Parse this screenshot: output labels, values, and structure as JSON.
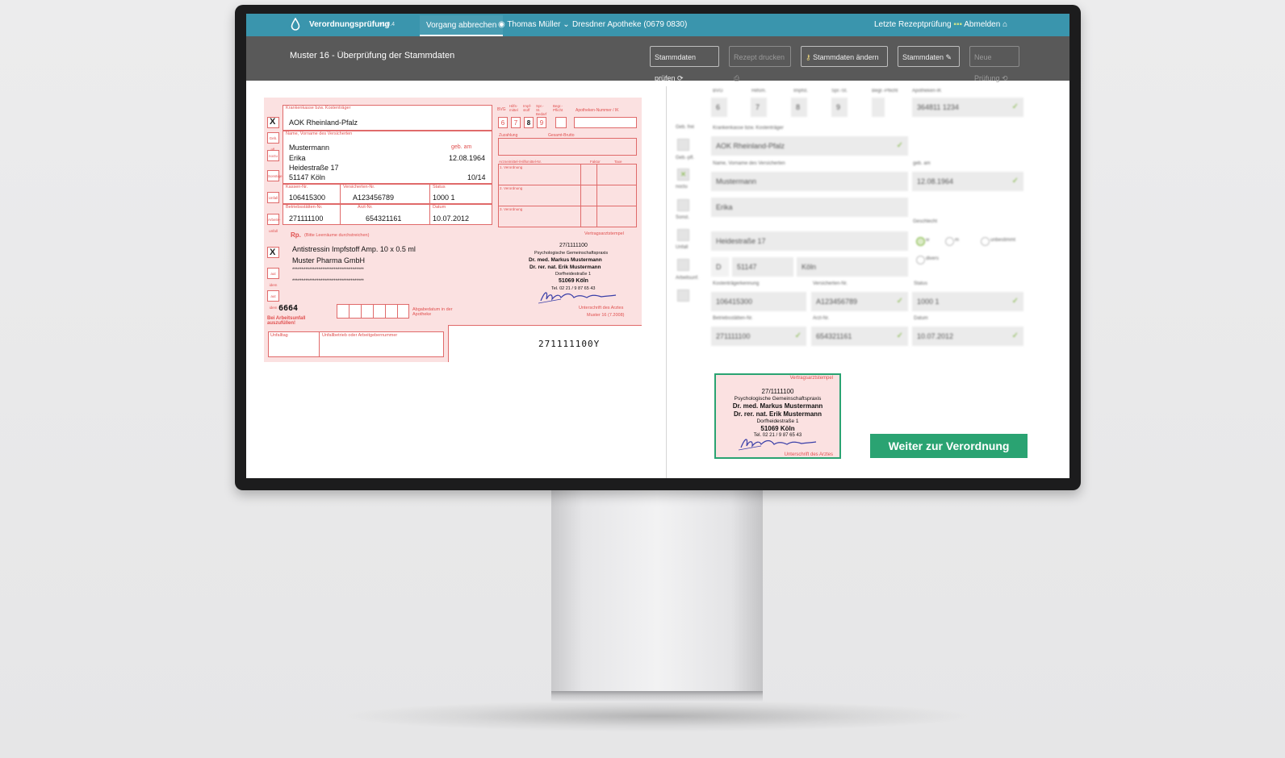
{
  "app": {
    "name": "Verordnungsprüfung",
    "version": "v1.0.4",
    "nav_tab": "Vorgang abbrechen",
    "user": "Thomas Müller",
    "pharmacy": "Dresdner Apotheke (0679 0830)",
    "right_info": "Letzte Rezeptprüfung",
    "logout": "Abmelden"
  },
  "header": {
    "title": "Muster 16 - Überprüfung der Stammdaten",
    "buttons": [
      {
        "label": "Stammdaten prüfen",
        "disabled": false
      },
      {
        "label": "Rezept drucken",
        "disabled": true
      },
      {
        "label": "Stammdaten ändern",
        "disabled": false
      },
      {
        "label": "Stammdaten",
        "disabled": false
      },
      {
        "label": "Neue Prüfung",
        "disabled": true
      }
    ]
  },
  "form": {
    "labels": {
      "krankenkasse": "Krankenkasse bzw. Kostenträger",
      "name": "Name, Vorname des Versicherten",
      "geb": "geb. am",
      "kassen_nr": "Kassen-Nr.",
      "versicherten_nr": "Versicherten-Nr.",
      "status": "Status",
      "betriebsstaetten_nr": "Betriebsstätten-Nr.",
      "arzt_nr": "Arzt-Nr.",
      "datum": "Datum",
      "rp": "Rp.",
      "rp_hint": "(Bitte Leerräume durchstreichen)",
      "vertragsarztstempel": "Vertragsarztstempel",
      "unterschrift": "Unterschrift des Arztes",
      "muster": "Muster 16 (7.2008)",
      "abgabedatum": "Abgabedatum in der Apotheke",
      "arbeitsunfall": "Bei Arbeitsunfall auszufüllen!",
      "unfalltag": "Unfalltag",
      "unfallbetrieb": "Unfallbetrieb oder Arbeitgebernummer",
      "apotheken_nr": "Apotheken-Nummer / IK",
      "zuzahlung": "Zuzahlung",
      "gesamt_brutto": "Gesamt-Brutto",
      "arzneimittel": "Arzneimittel-/Hilfsmittel-Nr.",
      "faktor": "Faktor",
      "taxe": "Taxe",
      "verordnung1": "1. Verordnung",
      "verordnung2": "2. Verordnung",
      "verordnung3": "3. Verordnung",
      "bvg": "BVG",
      "hilfsmittel": "Hilfs-mittel",
      "impfstoff": "Impf-stoff",
      "spr": "Spr.-St. Bedarf",
      "begr": "Begr.-Pflicht"
    },
    "side_boxes": [
      "Geb. pfl.",
      "noctu",
      "Sonstige",
      "Unfall",
      "Arbeits-unfall"
    ],
    "rp_side_boxes": [
      "aut idem",
      "aut idem",
      "aut idem"
    ],
    "kasse": "AOK Rheinland-Pfalz",
    "nachname": "Mustermann",
    "vorname": "Erika",
    "strasse": "Heidestraße 17",
    "ort": "51147 Köln",
    "geburtsdatum": "12.08.1964",
    "gueltig": "10/14",
    "kassen_nr": "106415300",
    "versicherten_nr": "A123456789",
    "status": "1000 1",
    "betriebsstaetten_nr": "271111100",
    "arzt_nr": "654321161",
    "datum": "10.07.2012",
    "digits": [
      "6",
      "7",
      "8",
      "9"
    ],
    "medikament": "Antistressin Impfstoff Amp. 10 x 0.5 ml",
    "hersteller": "Muster Pharma GmbH",
    "stars1": "**************************************",
    "stars2": "**************************************",
    "handnum": "6664",
    "barcode_text": "271111100Y",
    "stempel": {
      "nr": "27/1111100",
      "praxis": "Psychologische Gemeinschaftspraxis",
      "arzt1": "Dr. med. Markus Mustermann",
      "arzt2": "Dr. rer. nat. Erik Mustermann",
      "strasse": "Dorfheidestraße 1",
      "ort": "51069 Köln",
      "tel": "Tel. 02 21 / 9 87 65 43"
    }
  },
  "right_panel": {
    "top_labels": [
      "BVG",
      "Hilfsm.",
      "Impfst.",
      "Spr.-St.",
      "Begr.-Pflicht",
      "Apotheken-IK"
    ],
    "top_values": [
      "6",
      "7",
      "8",
      "9",
      "",
      "364811 1234"
    ],
    "side_labels": [
      "Geb. frei",
      "Geb.-pfl.",
      "noctu",
      "Sonst.",
      "Unfall",
      "Arbeitsunf."
    ],
    "kasse_label": "Krankenkasse bzw. Kostenträger",
    "kasse_value": "AOK Rheinland-Pfalz",
    "name_label": "Name, Vorname des Versicherten",
    "name_value": "Mustermann",
    "geb_label": "geb. am",
    "geb_value": "12.08.1964",
    "vorname_value": "Erika",
    "strasse_value": "Heidestraße 17",
    "geschlecht_label": "Geschlecht",
    "radio1": "w",
    "radio2": "m",
    "radio3": "unbestimmt",
    "radio4": "divers",
    "land_value": "D",
    "plz_value": "51147",
    "ort_value": "Köln",
    "kassen_label": "Kostenträgerkennung",
    "kassen_value": "106415300",
    "vers_label": "Versicherten-Nr.",
    "vers_value": "A123456789",
    "status_label": "Status",
    "status_value": "1000 1",
    "bsnr_label": "Betriebsstätten-Nr.",
    "bsnr_value": "271111100",
    "lanr_label": "Arzt-Nr.",
    "lanr_value": "654321161",
    "datum_label": "Datum",
    "datum_value": "10.07.2012"
  },
  "stamp": {
    "header": "Vertragsarztstempel",
    "footer": "Unterschrift des Arztes",
    "nr": "27/1111100",
    "praxis": "Psychologische Gemeinschaftspraxis",
    "arzt1": "Dr. med. Markus Mustermann",
    "arzt2": "Dr. rer. nat. Erik Mustermann",
    "strasse": "Dorfheidestraße 1",
    "ort": "51069 Köln",
    "tel": "Tel. 02 21 / 9 87 65 43"
  },
  "actions": {
    "weiter": "Weiter zur Verordnung"
  },
  "colors": {
    "topbar": "#3a95ad",
    "subbar": "#595959",
    "form_pink": "#fbe1e1",
    "form_red": "#e06a6a",
    "accent_green": "#2aa372",
    "check_green": "#7bb33a"
  }
}
